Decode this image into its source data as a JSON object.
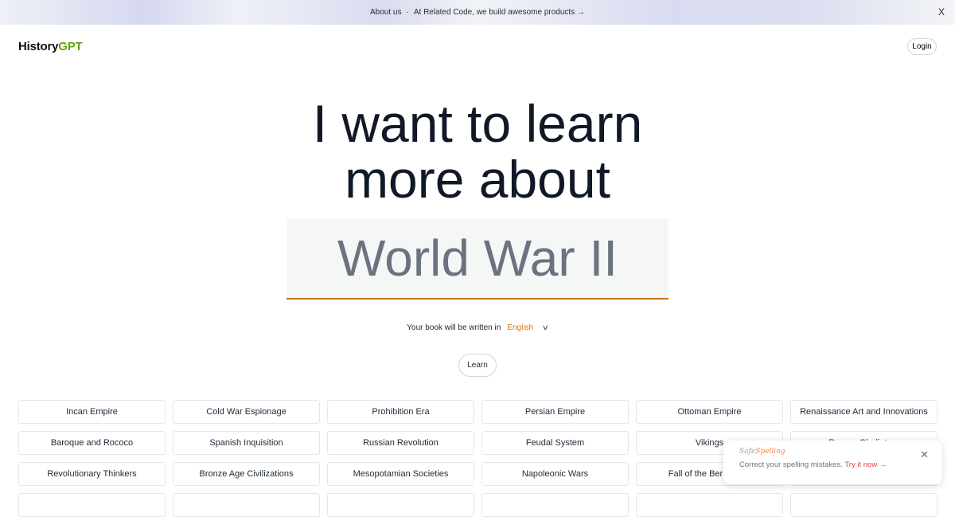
{
  "banner": {
    "about": "About us",
    "separator": "·",
    "promo": "At Related Code, we build awesome products →",
    "close": "X"
  },
  "header": {
    "logo_main": "History",
    "logo_accent": "GPT",
    "login": "Login"
  },
  "hero": {
    "line1": "I want to learn",
    "line2": "more about",
    "topic_value": "World War II"
  },
  "language": {
    "prefix": "Your book will be written in",
    "selected": "English",
    "chevron": "⌄"
  },
  "learn_label": "Learn",
  "topics": [
    "Incan Empire",
    "Cold War Espionage",
    "Prohibition Era",
    "Persian Empire",
    "Ottoman Empire",
    "Renaissance Art and Innovations",
    "Baroque and Rococo",
    "Spanish Inquisition",
    "Russian Revolution",
    "Feudal System",
    "Vikings",
    "Roman Gladiators",
    "Revolutionary Thinkers",
    "Bronze Age Civilizations",
    "Mesopotamian Societies",
    "Napoleonic Wars",
    "Fall of the Berlin Wall",
    "",
    "",
    "",
    "",
    "",
    "",
    ""
  ],
  "toast": {
    "brand_a": "Safe",
    "brand_b": "Spelling",
    "message": "Correct your spelling mistakes.",
    "cta": "Try it now →",
    "close": "✕"
  }
}
